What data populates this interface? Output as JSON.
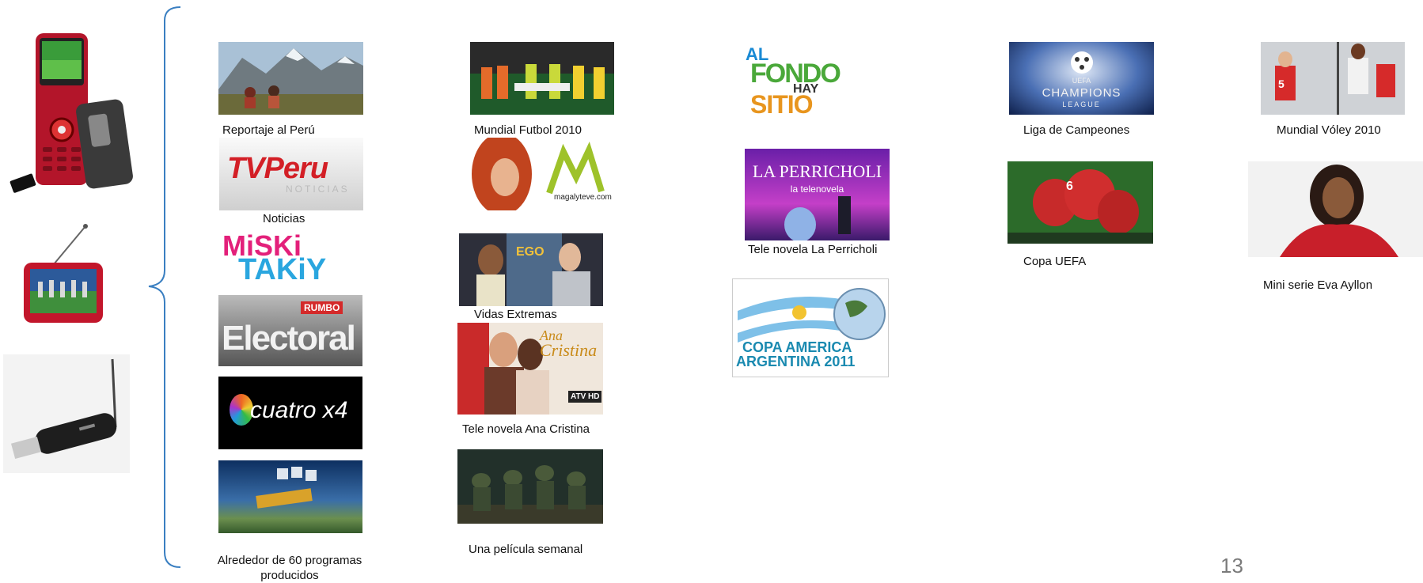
{
  "captions": {
    "peru": "Reportaje al Perú",
    "mundial_futbol": "Mundial Futbol 2010",
    "champions": "Liga de Campeones",
    "voley": "Mundial Vóley 2010",
    "noticias": "Noticias",
    "perricholi": "Tele novela La Perricholi",
    "uefa": "Copa UEFA",
    "eva": "Mini serie Eva Ayllon",
    "vidas": "Vidas Extremas",
    "ana": "Tele novela Ana Cristina",
    "pelicula": "Una película semanal",
    "alrededor_1": "Alrededor de 60 programas",
    "alrededor_2": "producidos"
  },
  "logos": {
    "tvperu_main": "TVPeru",
    "tvperu_sub": "NOTICIAS",
    "miski": "MiSKi",
    "taki": "TAKiY",
    "rumbo": "RUMBO",
    "electoral": "Electoral",
    "cuatro": "cuatro x4",
    "al_fondo_1": "AL",
    "al_fondo_2": "FONDO",
    "al_fondo_3": "HAY",
    "al_fondo_4": "SITIO",
    "perricholi": "LA PERRICHOLI",
    "perricholi_sub": "la telenovela",
    "copa_1": "COPA AMERICA",
    "copa_2": "ARGENTINA 2011",
    "champions_1": "UEFA",
    "champions_2": "CHAMPIONS",
    "champions_3": "LEAGUE",
    "magaly": "magalyteve.com",
    "ana_1": "Ana",
    "ana_2": "Cristina",
    "atv": "ATV HD"
  },
  "page_number": "13",
  "colors": {
    "bracket": "#3a7fc1",
    "caption": "#111111",
    "page_number": "#7a7a7a"
  }
}
